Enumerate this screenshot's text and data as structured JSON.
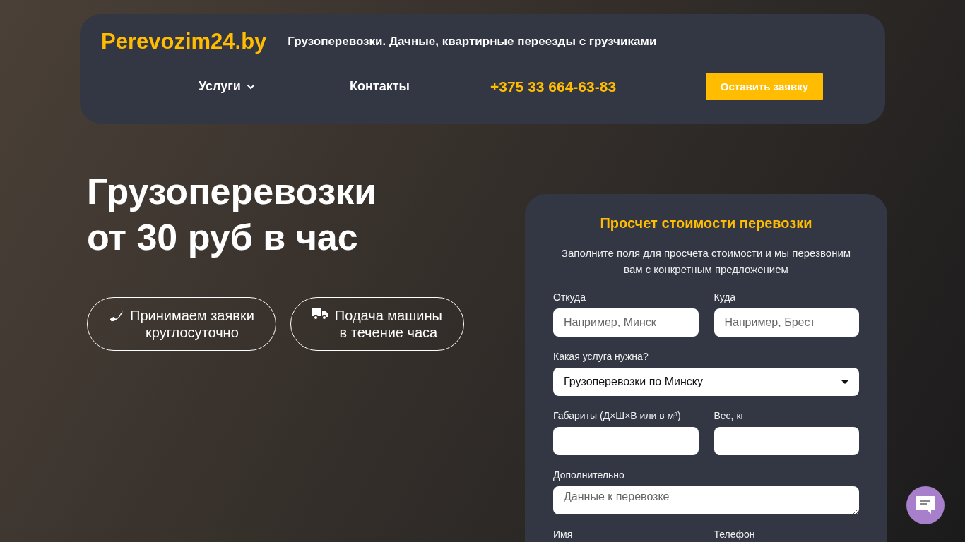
{
  "header": {
    "logo": "Perevozim24.by",
    "tagline": "Грузоперевозки. Дачные, квартирные переезды с грузчиками",
    "nav": [
      {
        "label": "Услуги",
        "kind": "dropdown"
      },
      {
        "label": "Контакты",
        "kind": "link"
      },
      {
        "label": "+375 33 664-63-83",
        "kind": "phone"
      }
    ],
    "cta": "Оставить заявку"
  },
  "hero": {
    "title_lines": [
      "Грузоперевозки",
      "от 30 руб в час"
    ],
    "features": [
      {
        "kind": "support",
        "lines": [
          "Принимаем заявки",
          "круглосуточно"
        ]
      },
      {
        "kind": "delivery",
        "lines": [
          "Подача машины",
          "в течение часа"
        ]
      }
    ]
  },
  "form": {
    "title": "Просчет стоимости перевозки",
    "intro": "Заполните поля для просчета стоимости и мы перезвоним вам с конкретным предложением",
    "rows": [
      [
        {
          "label": "Откуда",
          "kind": "text",
          "placeholder": "Например, Минск"
        },
        {
          "label": "Куда",
          "kind": "text",
          "placeholder": "Например, Брест"
        }
      ],
      [
        {
          "label": "Какая услуга нужна?",
          "kind": "select",
          "value": "Грузоперевозки по Минску"
        }
      ],
      [
        {
          "label": "Габариты (Д×Ш×В или в м³)",
          "kind": "text"
        },
        {
          "label": "Вес, кг",
          "kind": "text"
        }
      ],
      [
        {
          "label": "Дополнительно",
          "kind": "textarea",
          "placeholder": "Данные к перевозке"
        }
      ],
      [
        {
          "label": "Имя",
          "kind": "text"
        },
        {
          "label": "Телефон",
          "kind": "text"
        }
      ]
    ]
  }
}
